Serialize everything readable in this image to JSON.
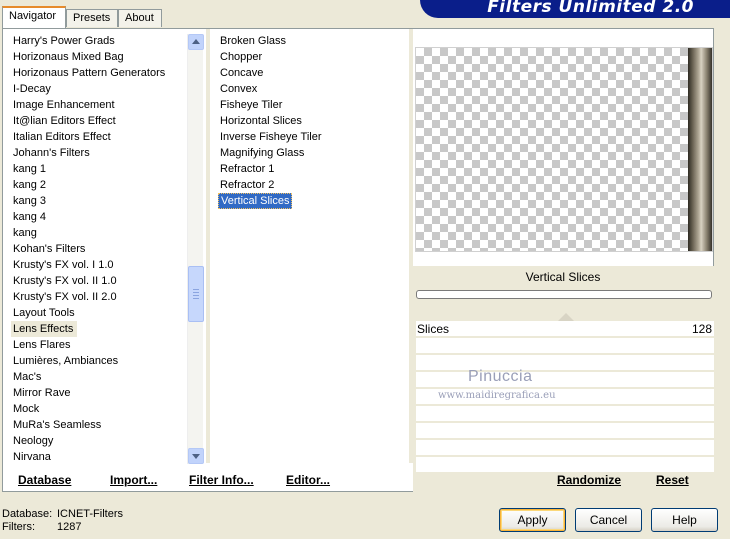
{
  "tabs": [
    {
      "label": "Navigator"
    },
    {
      "label": "Presets"
    },
    {
      "label": "About"
    }
  ],
  "banner": {
    "title": "Filters Unlimited 2.0"
  },
  "categories": [
    "Harry's Power Grads",
    "Horizonaus Mixed Bag",
    "Horizonaus Pattern Generators",
    "I-Decay",
    "Image Enhancement",
    "It@lian Editors Effect",
    "Italian Editors Effect",
    "Johann's Filters",
    "kang 1",
    "kang 2",
    "kang 3",
    "kang 4",
    "kang",
    "Kohan's Filters",
    "Krusty's FX vol. I 1.0",
    "Krusty's FX vol. II 1.0",
    "Krusty's FX vol. II 2.0",
    "Layout Tools",
    "Lens Effects",
    "Lens Flares",
    "Lumières, Ambiances",
    "Mac's",
    "Mirror Rave",
    "Mock",
    "MuRa's Seamless",
    "Neology",
    "Nirvana"
  ],
  "selected_category": "Lens Effects",
  "filters": [
    "Broken Glass",
    "Chopper",
    "Concave",
    "Convex",
    "Fisheye Tiler",
    "Horizontal Slices",
    "Inverse Fisheye Tiler",
    "Magnifying Glass",
    "Refractor 1",
    "Refractor 2",
    "Vertical Slices"
  ],
  "selected_filter": "Vertical Slices",
  "effect": {
    "name": "Vertical Slices",
    "param_label": "Slices",
    "param_value": "128"
  },
  "watermark": {
    "name": "Pinuccia",
    "site": "www.maidiregrafica.eu"
  },
  "links": {
    "database": "Database",
    "import": "Import...",
    "filter_info": "Filter Info...",
    "editor": "Editor...",
    "randomize": "Randomize",
    "reset": "Reset"
  },
  "status": {
    "database_label": "Database:",
    "database_value": "ICNET-Filters",
    "filters_label": "Filters:",
    "filters_value": "1287"
  },
  "buttons": {
    "apply": "Apply",
    "cancel": "Cancel",
    "help": "Help"
  },
  "colors": {
    "banner": "#0a1e8a",
    "selection": "#316ac5",
    "window": "#ece9d8"
  }
}
